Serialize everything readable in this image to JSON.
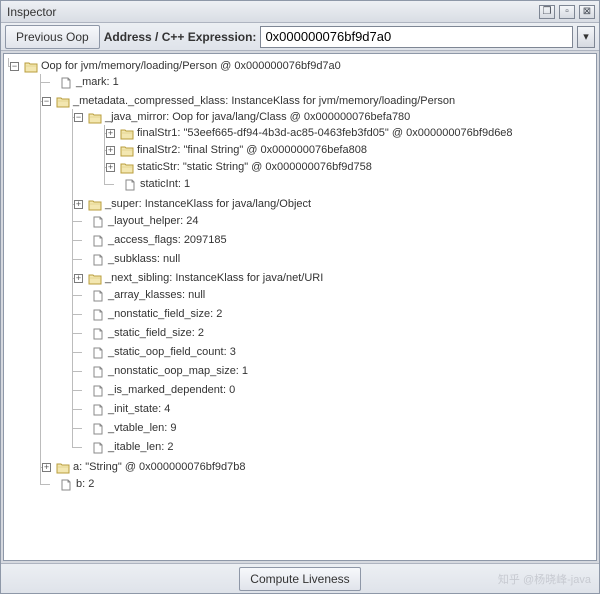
{
  "window": {
    "title": "Inspector",
    "btn_popout": "❐",
    "btn_min": "▫",
    "btn_close": "⊠"
  },
  "toolbar": {
    "prev_label": "Previous Oop",
    "addr_label": "Address / C++ Expression:",
    "addr_value": "0x000000076bf9d7a0",
    "dropdown_glyph": "▾"
  },
  "tree": {
    "n0": {
      "label": "Oop for jvm/memory/loading/Person @ 0x000000076bf9d7a0"
    },
    "n0_0": {
      "label": "_mark: 1"
    },
    "n0_1": {
      "label": "_metadata._compressed_klass: InstanceKlass for jvm/memory/loading/Person"
    },
    "n0_1_0": {
      "label": "_java_mirror: Oop for java/lang/Class @ 0x000000076befa780"
    },
    "n0_1_0_0": {
      "label": "finalStr1: \"53eef665-df94-4b3d-ac85-0463feb3fd05\" @ 0x000000076bf9d6e8"
    },
    "n0_1_0_1": {
      "label": "finalStr2: \"final String\" @ 0x000000076befa808"
    },
    "n0_1_0_2": {
      "label": "staticStr: \"static String\" @ 0x000000076bf9d758"
    },
    "n0_1_0_3": {
      "label": "staticInt: 1"
    },
    "n0_1_1": {
      "label": "_super: InstanceKlass for java/lang/Object"
    },
    "n0_1_2": {
      "label": "_layout_helper: 24"
    },
    "n0_1_3": {
      "label": "_access_flags: 2097185"
    },
    "n0_1_4": {
      "label": "_subklass: null"
    },
    "n0_1_5": {
      "label": "_next_sibling: InstanceKlass for java/net/URI"
    },
    "n0_1_6": {
      "label": "_array_klasses: null"
    },
    "n0_1_7": {
      "label": "_nonstatic_field_size: 2"
    },
    "n0_1_8": {
      "label": "_static_field_size: 2"
    },
    "n0_1_9": {
      "label": "_static_oop_field_count: 3"
    },
    "n0_1_10": {
      "label": "_nonstatic_oop_map_size: 1"
    },
    "n0_1_11": {
      "label": "_is_marked_dependent: 0"
    },
    "n0_1_12": {
      "label": "_init_state: 4"
    },
    "n0_1_13": {
      "label": "_vtable_len: 9"
    },
    "n0_1_14": {
      "label": "_itable_len: 2"
    },
    "n0_2": {
      "label": "a: \"String\" @ 0x000000076bf9d7b8"
    },
    "n0_3": {
      "label": "b: 2"
    }
  },
  "bottom": {
    "compute_label": "Compute Liveness",
    "watermark": "知乎 @杨晓峰-java"
  },
  "icons": {
    "folder": "folder",
    "file": "file"
  }
}
